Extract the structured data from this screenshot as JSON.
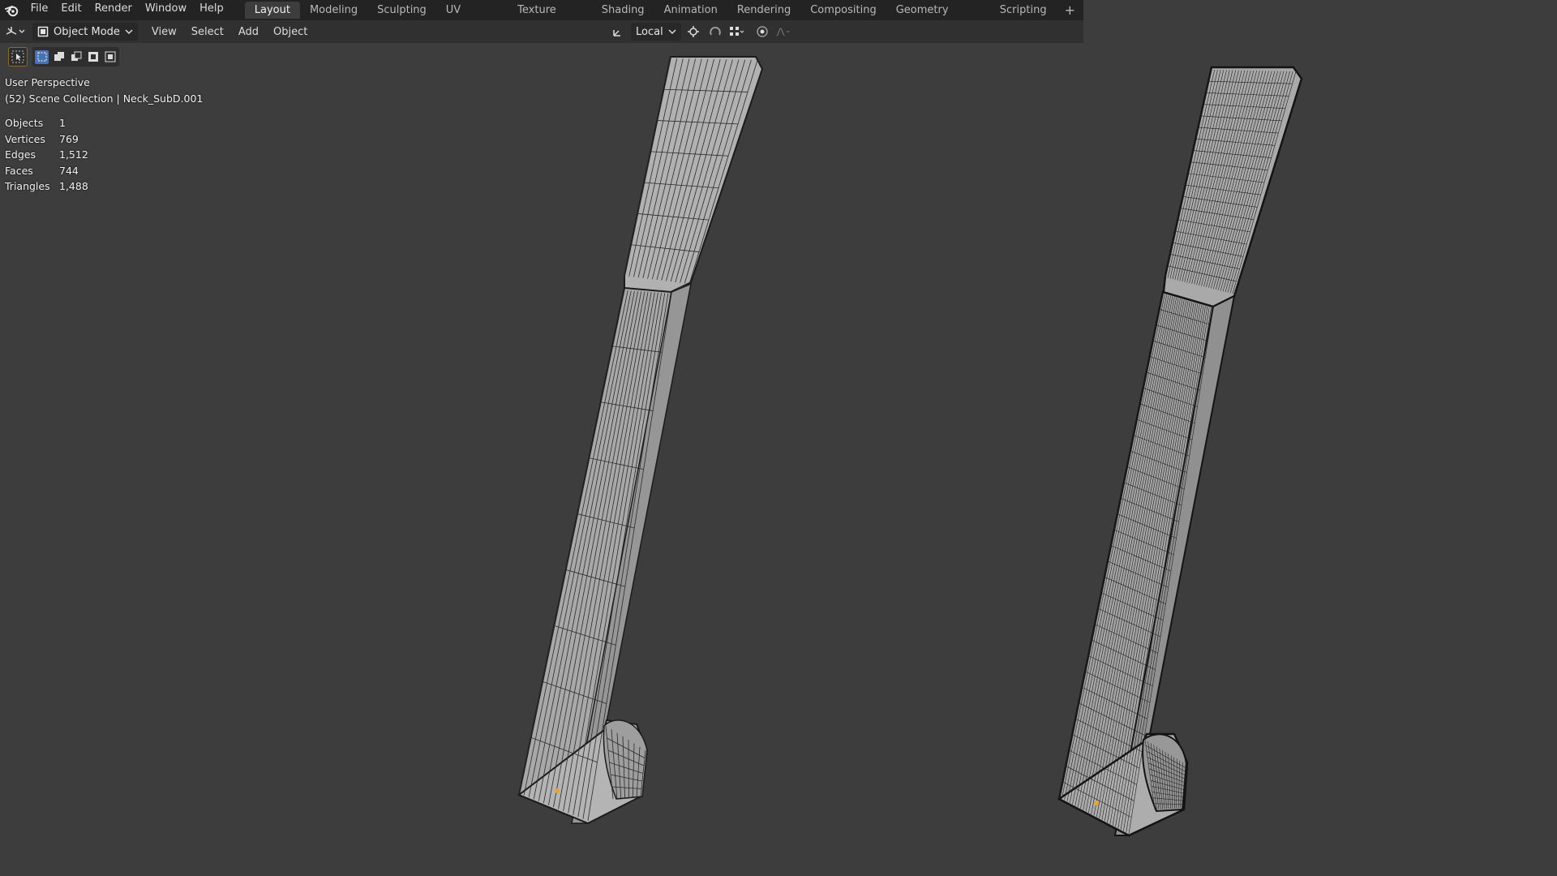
{
  "menu": [
    "File",
    "Edit",
    "Render",
    "Window",
    "Help"
  ],
  "workspaces": [
    "Layout",
    "Modeling",
    "Sculpting",
    "UV Editing",
    "Texture Paint",
    "Shading",
    "Animation",
    "Rendering",
    "Compositing",
    "Geometry Nodes",
    "Scripting"
  ],
  "active_workspace": "Layout",
  "header": {
    "mode": "Object Mode",
    "menus": [
      "View",
      "Select",
      "Add",
      "Object"
    ],
    "transform_orientation": "Local"
  },
  "overlay": {
    "view_name": "User Perspective",
    "collection": "(52) Scene Collection | Neck_SubD.001",
    "stats": [
      {
        "label": "Objects",
        "value": "1"
      },
      {
        "label": "Vertices",
        "value": "769"
      },
      {
        "label": "Edges",
        "value": "1,512"
      },
      {
        "label": "Faces",
        "value": "744"
      },
      {
        "label": "Triangles",
        "value": "1,488"
      }
    ]
  },
  "colors": {
    "viewport_bg": "#3d3d3d",
    "mesh_fill": "#a9a9a9",
    "wire": "#1e1e1e",
    "origin": "#e8a23a",
    "active_accent": "#4772b3"
  }
}
